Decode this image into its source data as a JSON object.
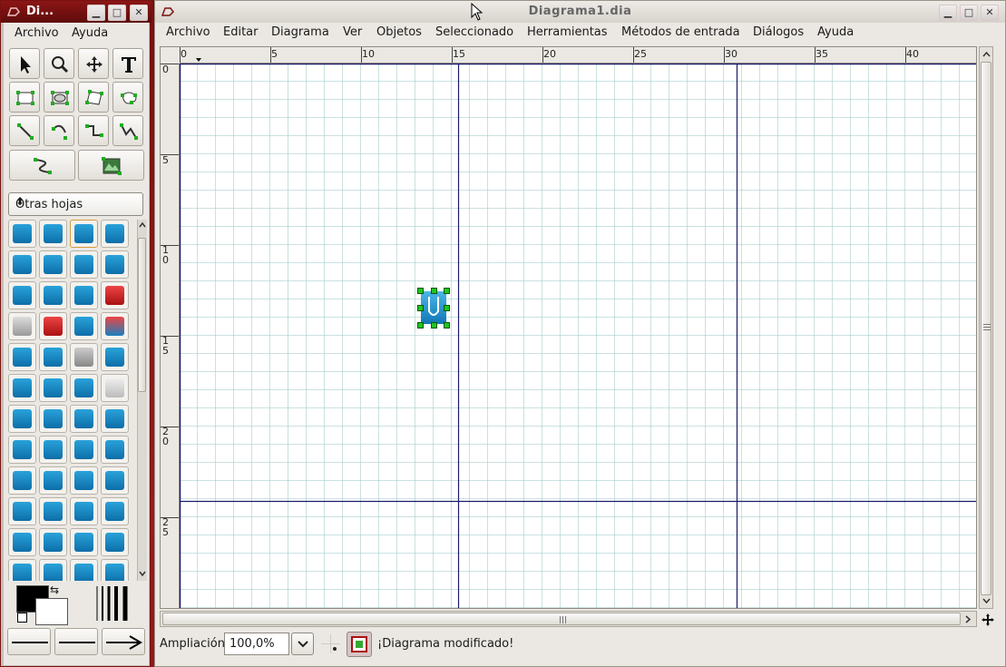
{
  "toolbox": {
    "title": "Di...",
    "window_buttons": {
      "minimize": "▁",
      "maximize": "□",
      "close": "✕"
    },
    "menu": {
      "file": "Archivo",
      "help": "Ayuda"
    },
    "sheet_selector": "Otras hojas"
  },
  "diagram": {
    "title": "Diagrama1.dia",
    "window_buttons": {
      "minimize": "▁",
      "maximize": "□",
      "close": "✕"
    },
    "menu": [
      "Archivo",
      "Editar",
      "Diagrama",
      "Ver",
      "Objetos",
      "Seleccionado",
      "Herramientas",
      "Métodos de entrada",
      "Diálogos",
      "Ayuda"
    ],
    "hruler": [
      "0",
      "5",
      "10",
      "15",
      "20",
      "25",
      "30",
      "35",
      "40"
    ],
    "vruler": [
      {
        "top": "0",
        "bottom": ""
      },
      {
        "top": "5",
        "bottom": ""
      },
      {
        "top": "1",
        "bottom": "0"
      },
      {
        "top": "1",
        "bottom": "5"
      },
      {
        "top": "2",
        "bottom": "0"
      },
      {
        "top": "2",
        "bottom": "5"
      }
    ],
    "status": {
      "zoom_label": "Ampliación",
      "zoom_value": "100,0%",
      "message": "¡Diagrama modificado!"
    }
  },
  "colors": {
    "accent_dark": "#7a1010",
    "page_line": "#1a1a6e",
    "grid_line": "#a0c8c8",
    "handle_green": "#22c322",
    "shape_blue": "#1b8bc8"
  }
}
